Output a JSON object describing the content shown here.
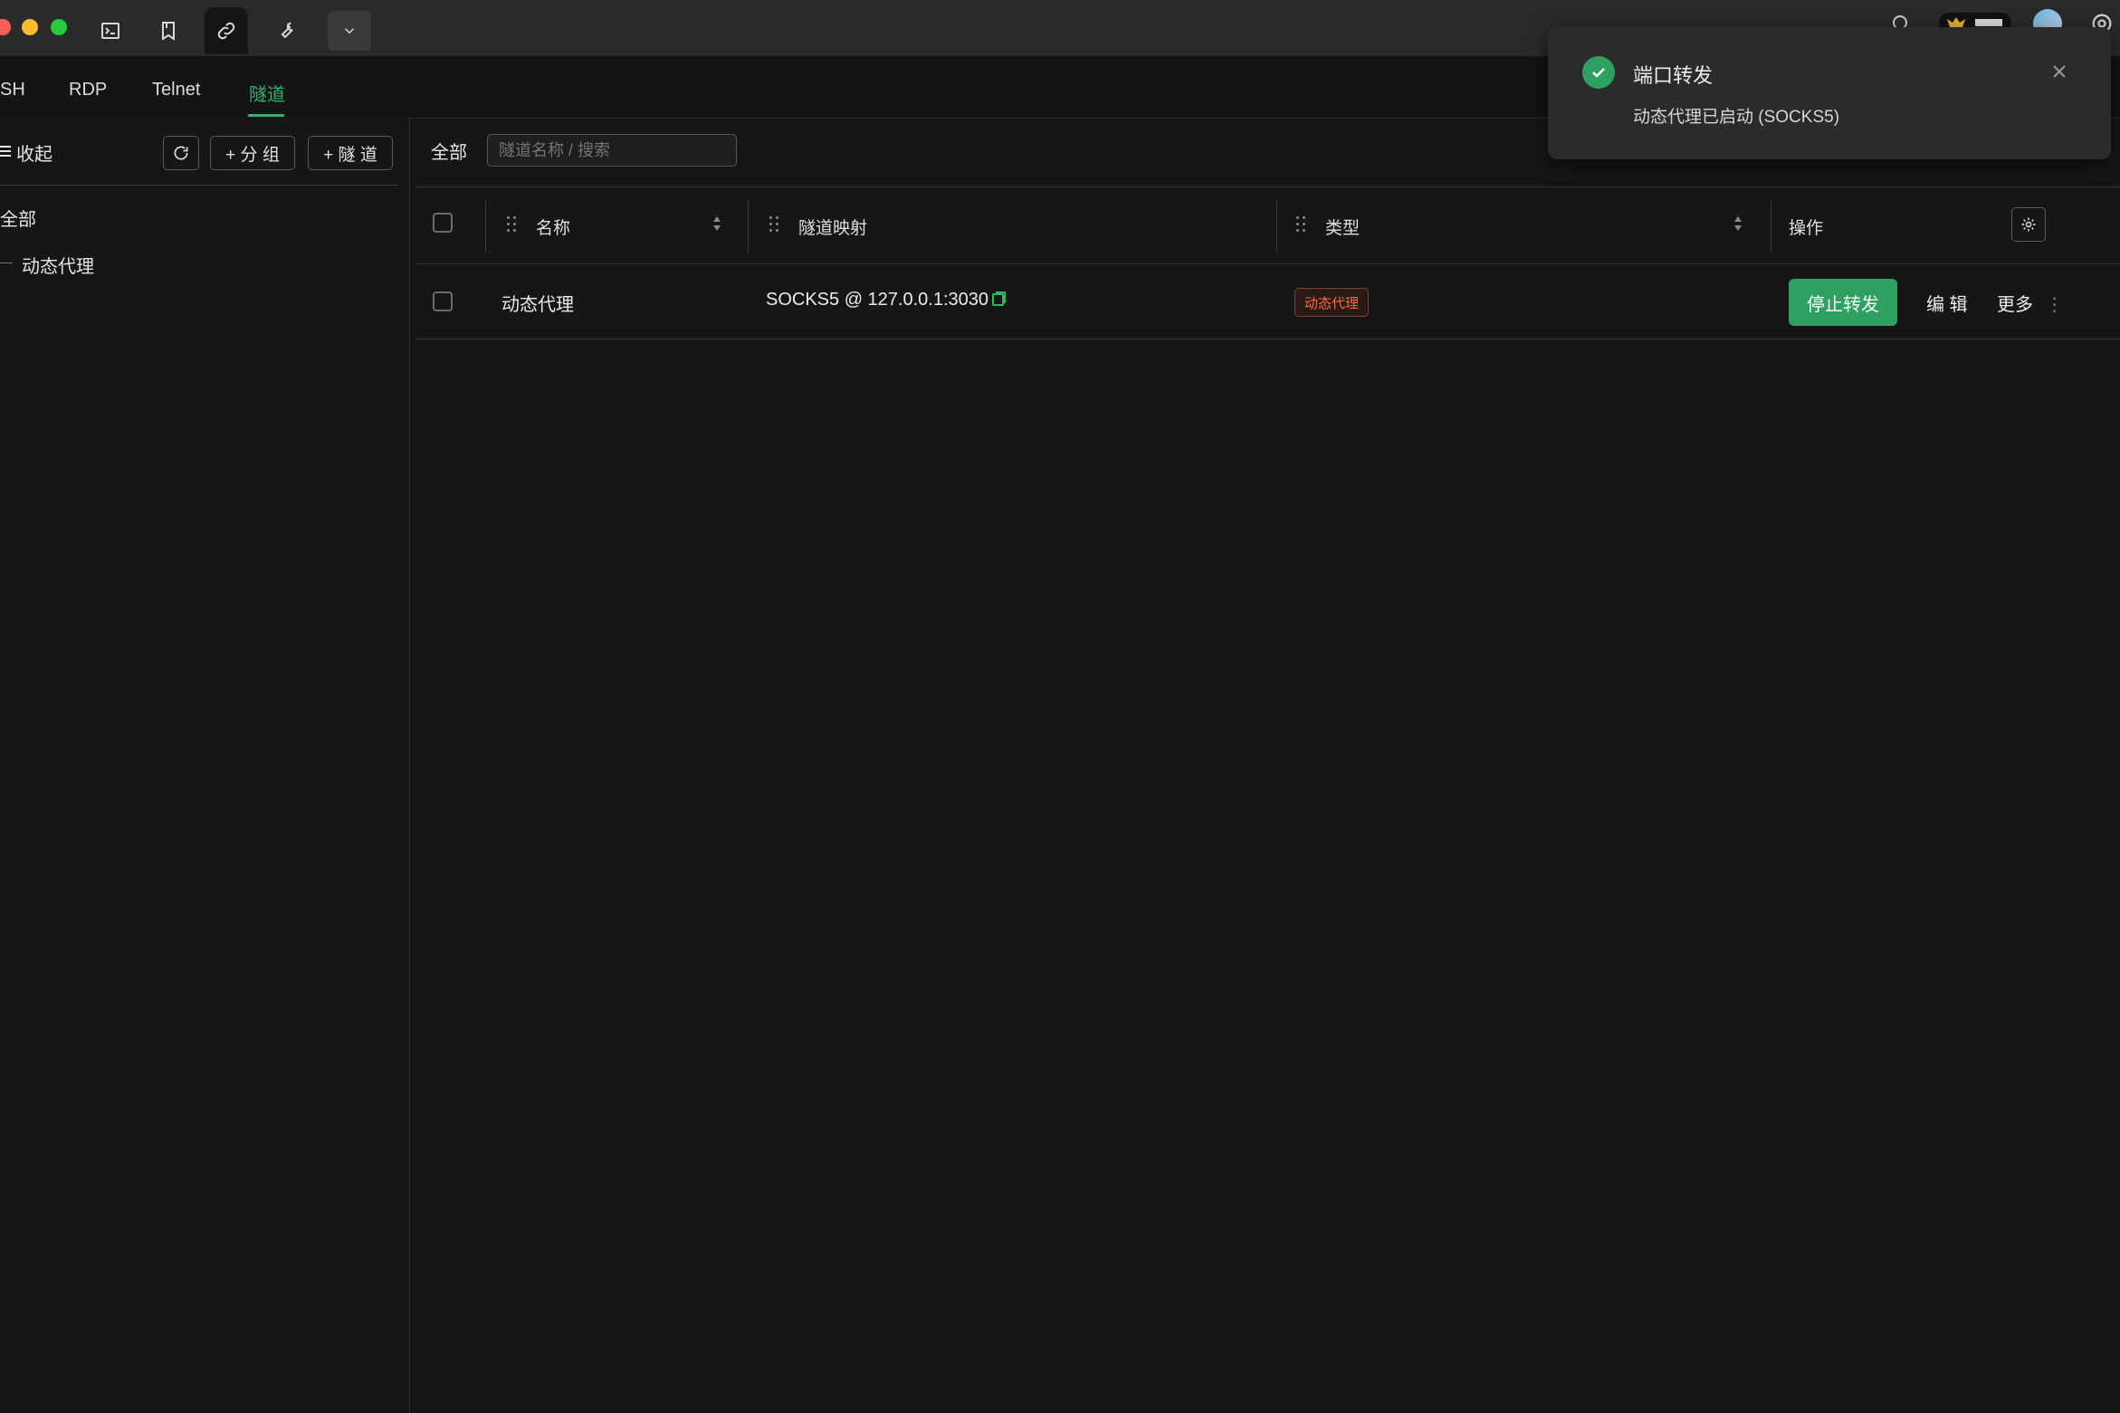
{
  "titlebar": {
    "icons": [
      "terminal-icon",
      "bookmark-icon",
      "link-icon",
      "wrench-icon",
      "chevron-down-icon"
    ],
    "right_icons": [
      "search-icon",
      "crown-badge-icon",
      "avatar",
      "settings-icon"
    ]
  },
  "tabs": [
    {
      "label": "SH",
      "active": false
    },
    {
      "label": "RDP",
      "active": false
    },
    {
      "label": "Telnet",
      "active": false
    },
    {
      "label": "隧道",
      "active": true
    }
  ],
  "sidebar": {
    "collapse_label": "收起",
    "add_group_label": "+ 分 组",
    "add_tunnel_label": "+ 隧 道",
    "tree": {
      "root_label": "全部",
      "children": [
        "动态代理"
      ]
    }
  },
  "main": {
    "filter_label": "全部",
    "search_placeholder": "隧道名称 / 搜索",
    "columns": {
      "name": "名称",
      "mapping": "隧道映射",
      "type": "类型",
      "actions": "操作"
    },
    "rows": [
      {
        "name": "动态代理",
        "mapping": "SOCKS5 @ 127.0.0.1:3030",
        "type": "动态代理",
        "primary_action": "停止转发",
        "edit": "编 辑",
        "more": "更多"
      }
    ]
  },
  "toast": {
    "title": "端口转发",
    "message": "动态代理已启动 (SOCKS5)"
  },
  "colors": {
    "accent": "#35b36b",
    "primary_button": "#2ea160",
    "badge_text": "#ff6a3d",
    "background": "#161616"
  }
}
